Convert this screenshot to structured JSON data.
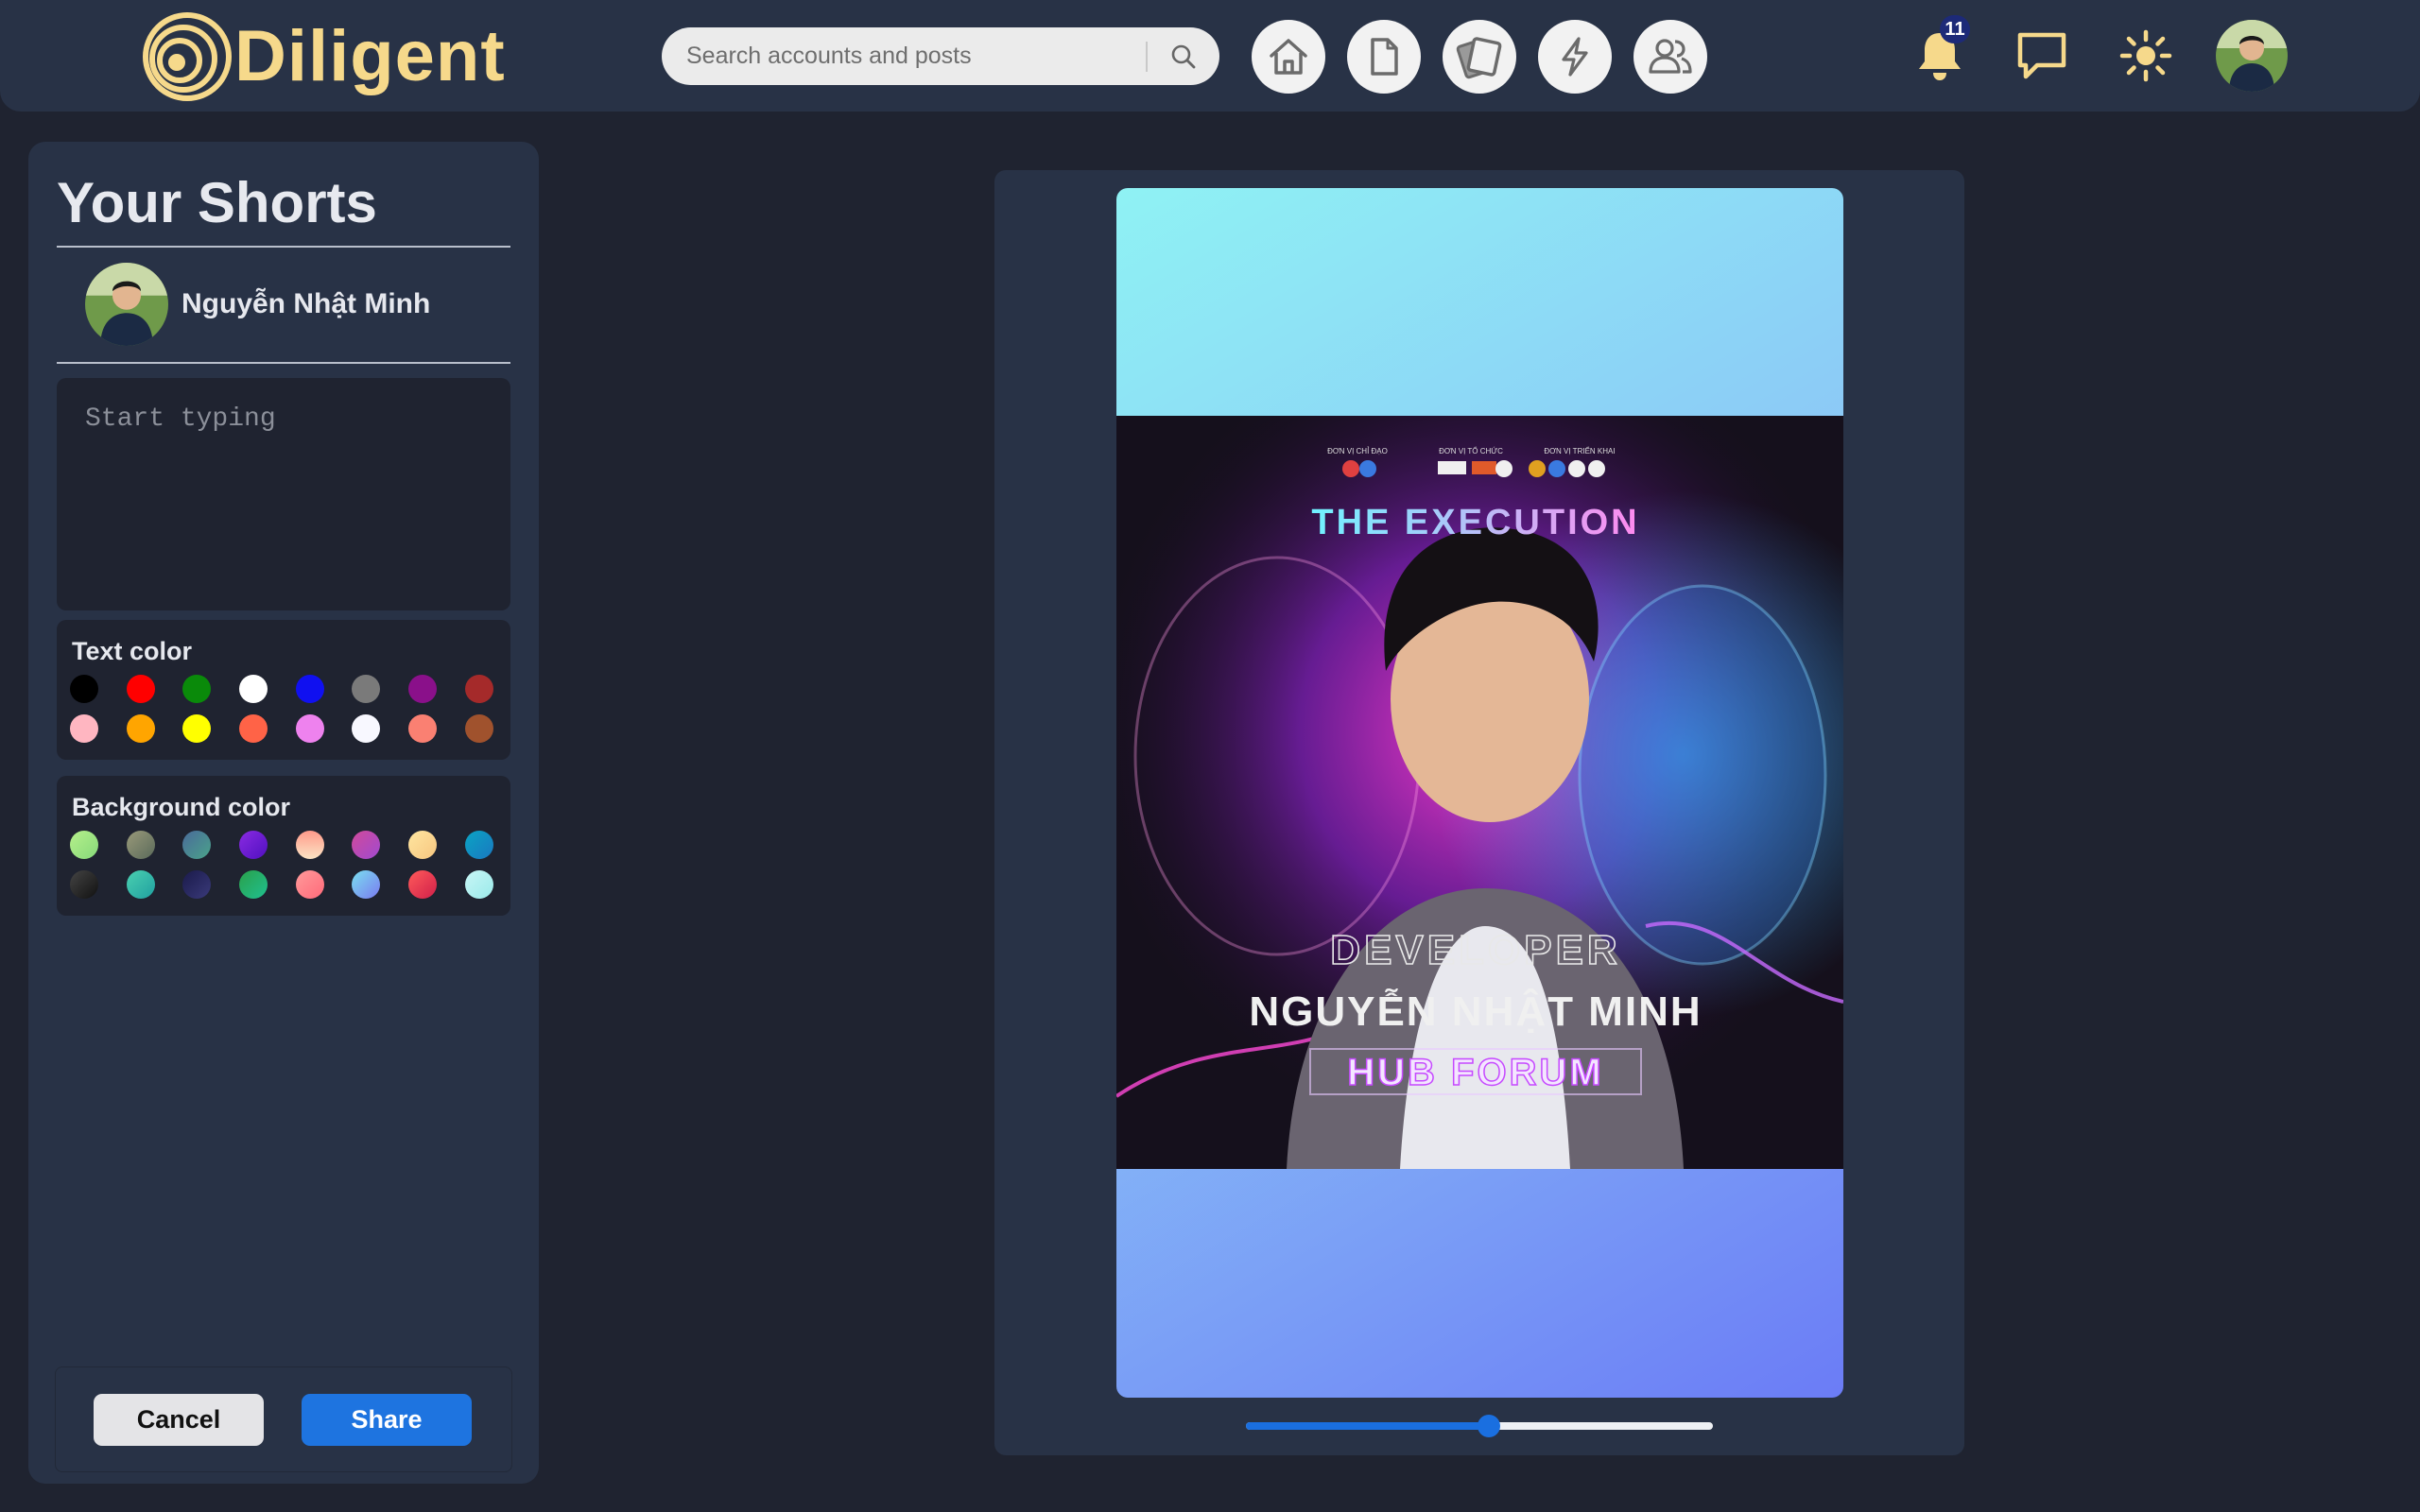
{
  "header": {
    "brand": "Diligent",
    "search": {
      "placeholder": "Search accounts and posts",
      "value": ""
    },
    "nav": [
      {
        "name": "home",
        "icon": "home-icon"
      },
      {
        "name": "posts",
        "icon": "document-icon"
      },
      {
        "name": "shorts",
        "icon": "cards-icon"
      },
      {
        "name": "activity",
        "icon": "lightning-icon"
      },
      {
        "name": "friends",
        "icon": "users-icon"
      }
    ],
    "notifications_count": "11",
    "accent_color": "#f6d98b"
  },
  "panel": {
    "title": "Your Shorts",
    "user_name": "Nguyễn Nhật Minh",
    "composer": {
      "placeholder": "Start typing",
      "value": ""
    },
    "text_color": {
      "label": "Text color",
      "swatches": [
        "#000000",
        "#ff0000",
        "#0a8a0a",
        "#ffffff",
        "#1010f0",
        "#7a7a7a",
        "#8a108a",
        "#a52a2a",
        "#ffb6c1",
        "#ffa500",
        "#ffff00",
        "#ff6347",
        "#ee82ee",
        "#f8f8ff",
        "#fa8072",
        "#a0522d"
      ]
    },
    "background_color": {
      "label": "Background color",
      "swatches": [
        "linear-gradient(135deg,#b6f08b,#86d97a)",
        "linear-gradient(135deg,#9a9a7a,#5a6a5a)",
        "linear-gradient(135deg,#4a6a9a,#4aa38a)",
        "linear-gradient(135deg,#8a2be2,#5010c0)",
        "linear-gradient(180deg,#ff9a8a,#fbe4c4)",
        "linear-gradient(135deg,#d04a9a,#a04ad0)",
        "linear-gradient(135deg,#ffe6a0,#f6c680)",
        "linear-gradient(135deg,#0aa4c4,#1a78c0)",
        "linear-gradient(135deg,#444444,#111111)",
        "linear-gradient(135deg,#4ad0b0,#20a0a0)",
        "linear-gradient(135deg,#1a1a4a,#3a3a7a)",
        "linear-gradient(135deg,#2aa04a,#20c090)",
        "linear-gradient(135deg,#ff9a9a,#ff6a7a)",
        "linear-gradient(135deg,#7ae0f0,#7a7af0)",
        "linear-gradient(135deg,#ff5a5a,#d0204a)",
        "linear-gradient(135deg,#c8f6f6,#9aeaea)"
      ]
    },
    "cancel_label": "Cancel",
    "share_label": "Share"
  },
  "preview": {
    "poster": {
      "headline": "THE EXECUTION",
      "role": "DEVELOPER",
      "name": "NGUYỄN NHẬT MINH",
      "event": "HUB FORUM",
      "sponsor_labels": [
        "ĐƠN VỊ CHỈ ĐẠO",
        "ĐƠN VỊ TỔ CHỨC",
        "ĐƠN VỊ TRIỂN KHAI"
      ]
    },
    "zoom_fraction": 0.52
  }
}
